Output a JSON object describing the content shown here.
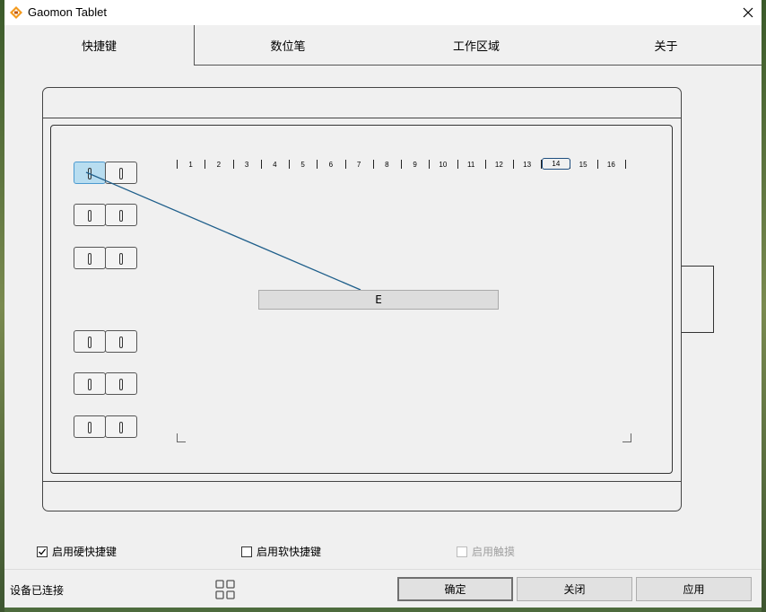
{
  "window": {
    "title": "Gaomon Tablet"
  },
  "tabs": [
    {
      "label": "快捷键",
      "active": true
    },
    {
      "label": "数位笔",
      "active": false
    },
    {
      "label": "工作区域",
      "active": false
    },
    {
      "label": "关于",
      "active": false
    }
  ],
  "touch_ring": {
    "labels": [
      "1",
      "2",
      "3",
      "4",
      "5",
      "6",
      "7",
      "8",
      "9",
      "10",
      "11",
      "12",
      "13",
      "14",
      "15",
      "16"
    ],
    "selected": "14"
  },
  "express_key_label": "E",
  "options": {
    "hard_keys": {
      "label": "启用硬快捷键",
      "checked": true,
      "enabled": true
    },
    "soft_keys": {
      "label": "启用软快捷键",
      "checked": false,
      "enabled": true
    },
    "touch": {
      "label": "启用触摸",
      "checked": false,
      "enabled": false
    }
  },
  "status": {
    "text": "设备已连接"
  },
  "buttons": {
    "ok": "确定",
    "close": "关闭",
    "apply": "应用"
  },
  "colors": {
    "selected_key": "#b8ddf0",
    "leader_line": "#1f5f8b"
  }
}
